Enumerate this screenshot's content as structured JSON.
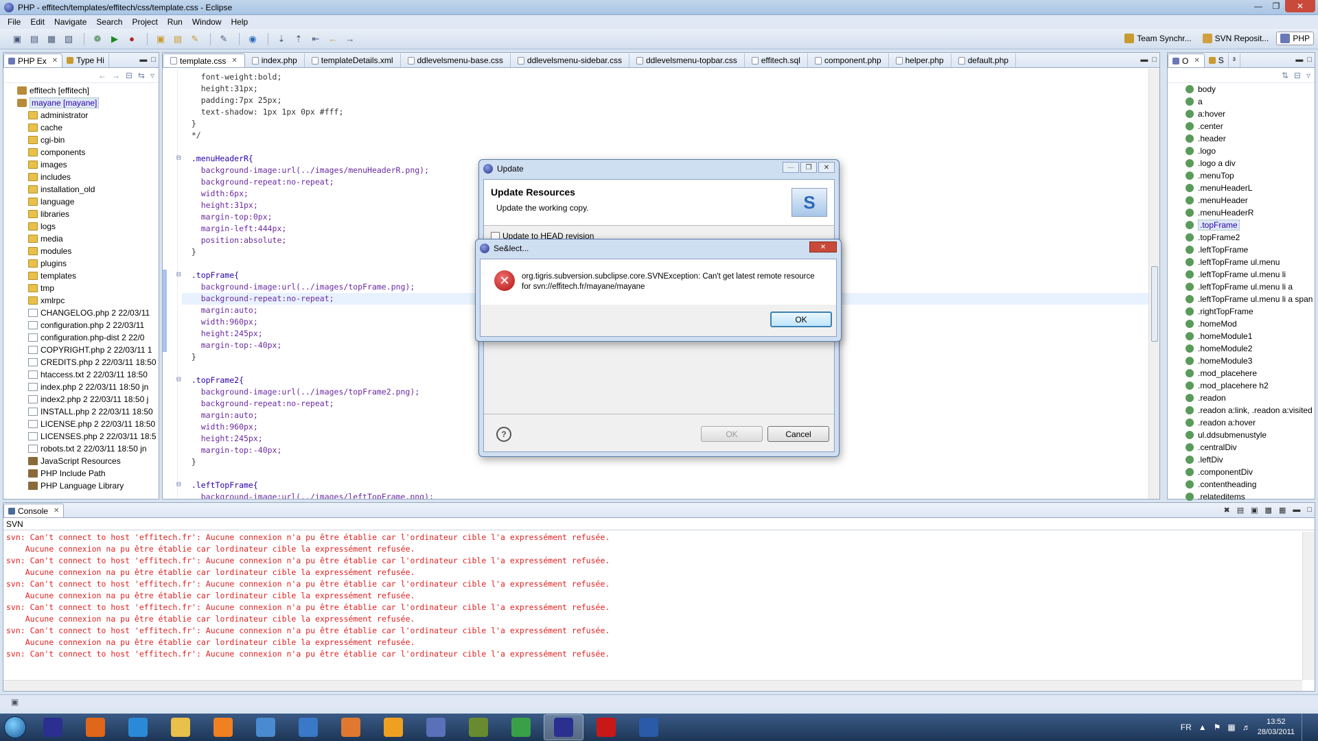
{
  "window": {
    "title": "PHP - effitech/templates/effitech/css/template.css - Eclipse"
  },
  "menubar": [
    "File",
    "Edit",
    "Navigate",
    "Search",
    "Project",
    "Run",
    "Window",
    "Help"
  ],
  "perspectives": [
    {
      "label": "Team Synchr...",
      "active": false
    },
    {
      "label": "SVN Reposit...",
      "active": false
    },
    {
      "label": "PHP",
      "active": true
    }
  ],
  "explorer": {
    "tabs": [
      {
        "label": "PHP Ex",
        "active": true
      },
      {
        "label": "Type Hi",
        "active": false
      }
    ],
    "tree": [
      {
        "label": "effitech [effitech]",
        "kind": "proj",
        "indent": 1
      },
      {
        "label": "mayane [mayane]",
        "kind": "proj",
        "indent": 1,
        "selected": true
      },
      {
        "label": "administrator",
        "kind": "folder",
        "indent": 2
      },
      {
        "label": "cache",
        "kind": "folder",
        "indent": 2
      },
      {
        "label": "cgi-bin",
        "kind": "folder",
        "indent": 2
      },
      {
        "label": "components",
        "kind": "folder",
        "indent": 2
      },
      {
        "label": "images",
        "kind": "folder",
        "indent": 2
      },
      {
        "label": "includes",
        "kind": "folder",
        "indent": 2
      },
      {
        "label": "installation_old",
        "kind": "folder",
        "indent": 2
      },
      {
        "label": "language",
        "kind": "folder",
        "indent": 2
      },
      {
        "label": "libraries",
        "kind": "folder",
        "indent": 2
      },
      {
        "label": "logs",
        "kind": "folder",
        "indent": 2
      },
      {
        "label": "media",
        "kind": "folder",
        "indent": 2
      },
      {
        "label": "modules",
        "kind": "folder",
        "indent": 2
      },
      {
        "label": "plugins",
        "kind": "folder",
        "indent": 2
      },
      {
        "label": "templates",
        "kind": "folder",
        "indent": 2
      },
      {
        "label": "tmp",
        "kind": "folder",
        "indent": 2
      },
      {
        "label": "xmlrpc",
        "kind": "folder",
        "indent": 2
      },
      {
        "label": "CHANGELOG.php 2  22/03/11",
        "kind": "file",
        "indent": 2
      },
      {
        "label": "configuration.php 2  22/03/11",
        "kind": "file",
        "indent": 2
      },
      {
        "label": "configuration.php-dist 2  22/0",
        "kind": "file",
        "indent": 2
      },
      {
        "label": "COPYRIGHT.php 2  22/03/11 1",
        "kind": "file",
        "indent": 2
      },
      {
        "label": "CREDITS.php 2  22/03/11 18:50",
        "kind": "file",
        "indent": 2
      },
      {
        "label": "htaccess.txt 2  22/03/11 18:50",
        "kind": "file",
        "indent": 2
      },
      {
        "label": "index.php 2  22/03/11 18:50  jn",
        "kind": "file",
        "indent": 2
      },
      {
        "label": "index2.php 2  22/03/11 18:50  j",
        "kind": "file",
        "indent": 2
      },
      {
        "label": "INSTALL.php 2  22/03/11 18:50",
        "kind": "file",
        "indent": 2
      },
      {
        "label": "LICENSE.php 2  22/03/11 18:50",
        "kind": "file",
        "indent": 2
      },
      {
        "label": "LICENSES.php 2  22/03/11 18:5",
        "kind": "file",
        "indent": 2
      },
      {
        "label": "robots.txt 2  22/03/11 18:50  jn",
        "kind": "file",
        "indent": 2
      },
      {
        "label": "JavaScript Resources",
        "kind": "lib",
        "indent": 2
      },
      {
        "label": "PHP Include Path",
        "kind": "lib",
        "indent": 2
      },
      {
        "label": "PHP Language Library",
        "kind": "lib",
        "indent": 2
      }
    ]
  },
  "editor": {
    "tabs": [
      {
        "label": "template.css",
        "active": true
      },
      {
        "label": "index.php",
        "active": false
      },
      {
        "label": "templateDetails.xml",
        "active": false
      },
      {
        "label": "ddlevelsmenu-base.css",
        "active": false
      },
      {
        "label": "ddlevelsmenu-sidebar.css",
        "active": false
      },
      {
        "label": "ddlevelsmenu-topbar.css",
        "active": false
      },
      {
        "label": "effitech.sql",
        "active": false
      },
      {
        "label": "component.php",
        "active": false
      },
      {
        "label": "helper.php",
        "active": false
      },
      {
        "label": "default.php",
        "active": false
      }
    ],
    "lines": [
      {
        "t": "    font-weight:bold;",
        "k": "plain"
      },
      {
        "t": "    height:31px;",
        "k": "plain"
      },
      {
        "t": "    padding:7px 25px;",
        "k": "plain"
      },
      {
        "t": "    text-shadow: 1px 1px 0px #fff;",
        "k": "plain"
      },
      {
        "t": "  }",
        "k": "plain"
      },
      {
        "t": "  */",
        "k": "plain"
      },
      {
        "t": "",
        "k": "plain"
      },
      {
        "t": "  .menuHeaderR{",
        "k": "sel",
        "fold": true
      },
      {
        "t": "    background-image:url(../images/menuHeaderR.png);",
        "k": "decl"
      },
      {
        "t": "    background-repeat:no-repeat;",
        "k": "decl"
      },
      {
        "t": "    width:6px;",
        "k": "decl"
      },
      {
        "t": "    height:31px;",
        "k": "decl"
      },
      {
        "t": "    margin-top:0px;",
        "k": "decl"
      },
      {
        "t": "    margin-left:444px;",
        "k": "decl"
      },
      {
        "t": "    position:absolute;",
        "k": "decl"
      },
      {
        "t": "  }",
        "k": "plain"
      },
      {
        "t": "",
        "k": "plain"
      },
      {
        "t": "  .topFrame{",
        "k": "sel",
        "fold": true
      },
      {
        "t": "    background-image:url(../images/topFrame.png);",
        "k": "decl"
      },
      {
        "t": "    background-repeat:no-repeat;",
        "k": "decl",
        "highlight": true
      },
      {
        "t": "    margin:auto;",
        "k": "decl"
      },
      {
        "t": "    width:960px;",
        "k": "decl"
      },
      {
        "t": "    height:245px;",
        "k": "decl"
      },
      {
        "t": "    margin-top:-40px;",
        "k": "decl"
      },
      {
        "t": "  }",
        "k": "plain"
      },
      {
        "t": "",
        "k": "plain"
      },
      {
        "t": "  .topFrame2{",
        "k": "sel",
        "fold": true
      },
      {
        "t": "    background-image:url(../images/topFrame2.png);",
        "k": "decl"
      },
      {
        "t": "    background-repeat:no-repeat;",
        "k": "decl"
      },
      {
        "t": "    margin:auto;",
        "k": "decl"
      },
      {
        "t": "    width:960px;",
        "k": "decl"
      },
      {
        "t": "    height:245px;",
        "k": "decl"
      },
      {
        "t": "    margin-top:-40px;",
        "k": "decl"
      },
      {
        "t": "  }",
        "k": "plain"
      },
      {
        "t": "",
        "k": "plain"
      },
      {
        "t": "  .leftTopFrame{",
        "k": "sel",
        "fold": true
      },
      {
        "t": "    background-image:url(../images/leftTopFrame.png);",
        "k": "decl"
      }
    ]
  },
  "outline": {
    "tabs": [
      {
        "label": "O",
        "active": true
      },
      {
        "label": "S",
        "active": false
      },
      {
        "label": "³",
        "active": false
      }
    ],
    "items": [
      "body",
      "a",
      "a:hover",
      ".center",
      ".header",
      ".logo",
      ".logo a div",
      ".menuTop",
      ".menuHeaderL",
      ".menuHeader",
      ".menuHeaderR",
      ".topFrame",
      ".topFrame2",
      ".leftTopFrame",
      ".leftTopFrame ul.menu",
      ".leftTopFrame ul.menu li",
      ".leftTopFrame ul.menu li a",
      ".leftTopFrame ul.menu li a span",
      ".rightTopFrame",
      ".homeMod",
      ".homeModule1",
      ".homeModule2",
      ".homeModule3",
      ".mod_placehere",
      ".mod_placehere h2",
      ".readon",
      ".readon a:link, .readon a:visited",
      ".readon a:hover",
      "ul.ddsubmenustyle",
      ".centralDiv",
      ".leftDiv",
      ".componentDiv",
      ".contentheading",
      ".relateditems"
    ],
    "selected": ".topFrame"
  },
  "console": {
    "tab": "Console",
    "sub": "SVN",
    "lines": [
      "svn: Can't connect to host 'effitech.fr': Aucune connexion n'a pu être établie car l'ordinateur cible l'a expressément refusée.",
      "    Aucune connexion na pu être établie car lordinateur cible la expressément refusée.",
      "svn: Can't connect to host 'effitech.fr': Aucune connexion n'a pu être établie car l'ordinateur cible l'a expressément refusée.",
      "    Aucune connexion na pu être établie car lordinateur cible la expressément refusée.",
      "svn: Can't connect to host 'effitech.fr': Aucune connexion n'a pu être établie car l'ordinateur cible l'a expressément refusée.",
      "    Aucune connexion na pu être établie car lordinateur cible la expressément refusée.",
      "svn: Can't connect to host 'effitech.fr': Aucune connexion n'a pu être établie car l'ordinateur cible l'a expressément refusée.",
      "    Aucune connexion na pu être établie car lordinateur cible la expressément refusée.",
      "svn: Can't connect to host 'effitech.fr': Aucune connexion n'a pu être établie car l'ordinateur cible l'a expressément refusée.",
      "    Aucune connexion na pu être établie car lordinateur cible la expressément refusée.",
      "svn: Can't connect to host 'effitech.fr': Aucune connexion n'a pu être établie car l'ordinateur cible l'a expressément refusée."
    ]
  },
  "update_dialog": {
    "title": "Update",
    "heading": "Update Resources",
    "description": "Update the working copy.",
    "checkbox_label": "Update to HEAD revision",
    "ok_label": "OK",
    "cancel_label": "Cancel"
  },
  "error_dialog": {
    "title": "Se&lect...",
    "message_line1": "org.tigris.subversion.subclipse.core.SVNException: Can't get latest remote resource",
    "message_line2": "for svn://effitech.fr/mayane/mayane",
    "ok_label": "OK"
  },
  "taskbar": {
    "lang": "FR",
    "time": "13:52",
    "date": "28/03/2011",
    "apps": [
      {
        "icon": "eclipse-icon",
        "color": "#2b2f8f"
      },
      {
        "icon": "firefox-icon",
        "color": "#e0661a"
      },
      {
        "icon": "ie-icon",
        "color": "#2a8ad8"
      },
      {
        "icon": "explorer-icon",
        "color": "#e8c04a"
      },
      {
        "icon": "media-player-icon",
        "color": "#f08020"
      },
      {
        "icon": "app-icon-5",
        "color": "#4a8ad0"
      },
      {
        "icon": "app-icon-6",
        "color": "#3a78c8"
      },
      {
        "icon": "app-icon-7",
        "color": "#e07830"
      },
      {
        "icon": "outlook-icon",
        "color": "#f0a020"
      },
      {
        "icon": "app-icon-9",
        "color": "#5a70b8"
      },
      {
        "icon": "app-icon-10",
        "color": "#6a8a30"
      },
      {
        "icon": "app-icon-11",
        "color": "#3aa048"
      },
      {
        "icon": "eclipse-running-icon",
        "color": "#2b2f8f",
        "active": true
      },
      {
        "icon": "filezilla-icon",
        "color": "#c81818"
      },
      {
        "icon": "word-icon",
        "color": "#2a5aa8"
      }
    ]
  }
}
